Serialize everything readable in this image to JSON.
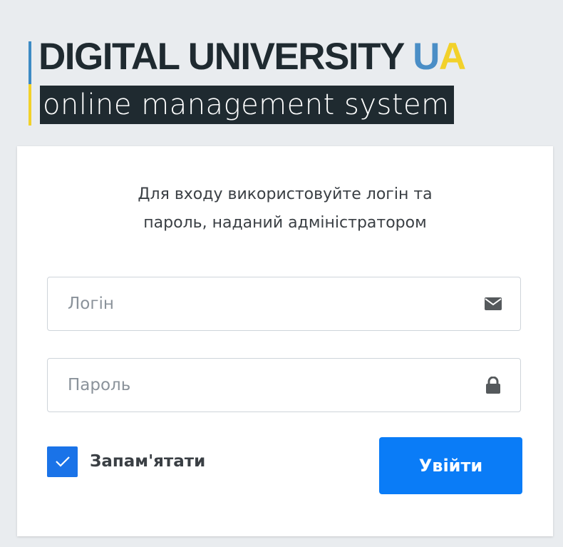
{
  "brand": {
    "title_main": "DIGITAL UNIVERSITY ",
    "title_u": "U",
    "title_a": "A",
    "subtitle": "online management system",
    "colors": {
      "blue": "#4a8ec6",
      "yellow": "#f2d12a",
      "dark": "#1f2a30"
    }
  },
  "form": {
    "intro_line1": "Для входу використовуйте логін та",
    "intro_line2": "пароль, наданий адміністратором",
    "login_placeholder": "Логін",
    "login_icon": "envelope-icon",
    "password_placeholder": "Пароль",
    "password_icon": "lock-icon",
    "remember_label": "Запам'ятати",
    "remember_checked": true,
    "submit_label": "Увійти",
    "accent_color": "#0a7cf7"
  }
}
